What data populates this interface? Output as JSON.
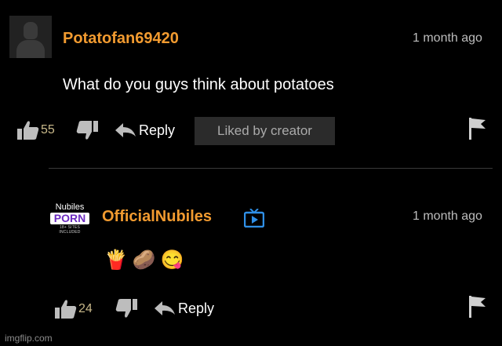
{
  "comments": [
    {
      "username": "Potatofan69420",
      "timestamp": "1 month ago",
      "text": "What do you guys think about potatoes",
      "likes": "55",
      "reply_label": "Reply",
      "liked_by_creator": "Liked by creator",
      "avatar": "default-user-avatar"
    },
    {
      "username": "OfficialNubiles",
      "timestamp": "1 month ago",
      "emojis": [
        "🍟",
        "🥔",
        "😋"
      ],
      "likes": "24",
      "reply_label": "Reply",
      "avatar_logo": {
        "top": "Nubiles",
        "middle": "PORN",
        "bottom": "18+ SITES INCLUDED"
      },
      "verified_icon": "tv-icon"
    }
  ],
  "watermark": "imgflip.com",
  "colors": {
    "background": "#000000",
    "username": "#f29b30",
    "like_count": "#c9b98a",
    "badge_bg": "#2b2b2b",
    "verified": "#2f8fe6"
  }
}
